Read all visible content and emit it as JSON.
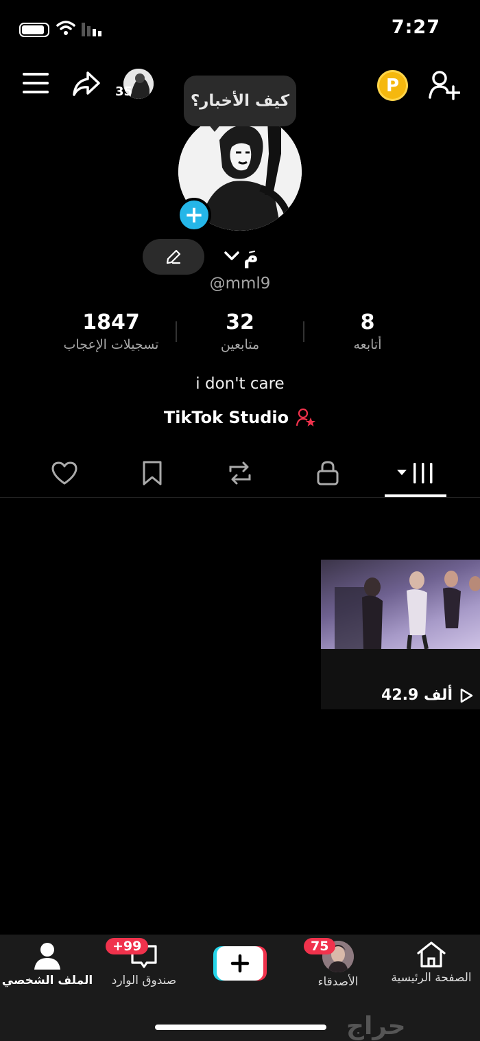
{
  "status_bar": {
    "time": "7:27"
  },
  "header": {
    "followed_avatar_count": "35",
    "coin_label": "P"
  },
  "bubble": {
    "text": "كيف الأخبار؟"
  },
  "profile": {
    "display_name": "مَ",
    "handle": "@mml9",
    "bio": "i don't care",
    "studio_label": "TikTok Studio"
  },
  "stats": [
    {
      "value": "8",
      "label": "أتابعه"
    },
    {
      "value": "32",
      "label": "متابعين"
    },
    {
      "value": "1847",
      "label": "تسجيلات الإعجاب"
    }
  ],
  "tabs": [
    {
      "icon": "liked-heart-icon"
    },
    {
      "icon": "bookmark-icon"
    },
    {
      "icon": "repost-icon"
    },
    {
      "icon": "lock-icon"
    },
    {
      "icon": "grid-icon",
      "active": true
    }
  ],
  "videos": [
    {
      "views": "42.9 ألف"
    }
  ],
  "bottom_nav": {
    "home": "الصفحة الرئيسية",
    "friends": "الأصدقاء",
    "friends_badge": "75",
    "inbox": "صندوق الوارد",
    "inbox_badge": "+99",
    "profile": "الملف الشخصي"
  },
  "watermark": "حراج",
  "colors": {
    "accent_blue": "#25b6e8",
    "badge_red": "#f0324c",
    "coin_yellow": "#f5b80e"
  }
}
